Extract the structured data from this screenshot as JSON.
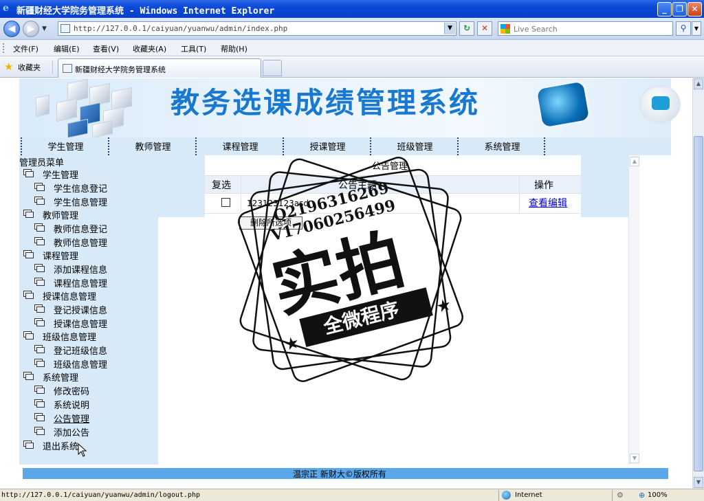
{
  "window": {
    "title": "新疆财经大学院务管理系统 - Windows Internet Explorer",
    "minimize_glyph": "_",
    "maximize_glyph": "❐",
    "close_glyph": "✕"
  },
  "address": {
    "url": "http://127.0.0.1/caiyuan/yuanwu/admin/index.php",
    "search_placeholder": "Live Search",
    "back_glyph": "◀",
    "forward_glyph": "▶",
    "refresh_glyph": "↻",
    "stop_glyph": "✕",
    "search_glyph": "⚲"
  },
  "menu": {
    "items": [
      "文件(F)",
      "编辑(E)",
      "查看(V)",
      "收藏夹(A)",
      "工具(T)",
      "帮助(H)"
    ]
  },
  "favorites": {
    "label": "收藏夹",
    "tab_label": "新疆财经大学院务管理系统"
  },
  "banner": {
    "title": "教务选课成绩管理系统"
  },
  "topnav": {
    "items": [
      "学生管理",
      "教师管理",
      "课程管理",
      "授课管理",
      "班级管理",
      "系统管理"
    ]
  },
  "sidebar": {
    "heading": "管理员菜单",
    "groups": [
      {
        "label": "学生管理",
        "children": [
          "学生信息登记",
          "学生信息管理"
        ]
      },
      {
        "label": "教师管理",
        "children": [
          "教师信息登记",
          "教师信息管理"
        ]
      },
      {
        "label": "课程管理",
        "children": [
          "添加课程信息",
          "课程信息管理"
        ]
      },
      {
        "label": "授课信息管理",
        "children": [
          "登记授课信息",
          "授课信息管理"
        ]
      },
      {
        "label": "班级信息管理",
        "children": [
          "登记班级信息",
          "班级信息管理"
        ]
      },
      {
        "label": "系统管理",
        "children": [
          "修改密码",
          "系统说明",
          "公告管理",
          "添加公告"
        ]
      },
      {
        "label": "退出系统",
        "children": []
      }
    ]
  },
  "content": {
    "section_title": "公告管理",
    "columns": [
      "复选",
      "公告主题",
      "操作"
    ],
    "rows": [
      {
        "subject": "123123123asd",
        "action": "查看编辑"
      }
    ],
    "delete_button": "删除所选项"
  },
  "stamp": {
    "line1": "Q2196316269",
    "line2": "V17060256499",
    "big_text": "实拍",
    "ribbon_text": "全微程序"
  },
  "footer": {
    "text": "温宗正  新财大©版权所有"
  },
  "status": {
    "url": "http://127.0.0.1/caiyuan/yuanwu/admin/logout.php",
    "zone": "Internet",
    "zoom": "100%"
  },
  "colors": {
    "title_bar": "#0a49d8",
    "panel_blue": "#d8eaf8",
    "banner_text": "#1a78cf",
    "footer_bar": "#5aa7ea",
    "link": "#0000cc"
  }
}
